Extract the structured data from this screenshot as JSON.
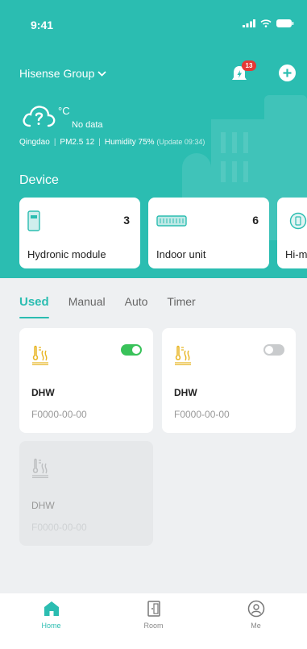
{
  "status_bar": {
    "time": "9:41"
  },
  "header": {
    "group_name": "Hisense Group",
    "notification_count": "13"
  },
  "weather": {
    "unit": "°C",
    "status": "No data",
    "city": "Qingdao",
    "pm25": "PM2.5 12",
    "humidity": "Humidity 75%",
    "updated": "(Update 09:34)"
  },
  "devices": {
    "title": "Device",
    "items": [
      {
        "name": "Hydronic module",
        "count": "3",
        "icon": "hydronic-module-icon"
      },
      {
        "name": "Indoor unit",
        "count": "6",
        "icon": "indoor-unit-icon"
      },
      {
        "name": "Hi-m",
        "count": "",
        "icon": "hi-m-icon"
      }
    ]
  },
  "scene_tabs": {
    "active": "Used",
    "items": [
      {
        "label": "Used"
      },
      {
        "label": "Manual"
      },
      {
        "label": "Auto"
      },
      {
        "label": "Timer"
      }
    ]
  },
  "scenes": [
    {
      "name": "DHW",
      "code": "F0000-00-00",
      "toggle": "on",
      "icon": "dhw-icon"
    },
    {
      "name": "DHW",
      "code": "F0000-00-00",
      "toggle": "off",
      "icon": "dhw-icon"
    },
    {
      "name": "DHW",
      "code": "F0000-00-00",
      "toggle": "none",
      "icon": "dhw-icon",
      "disabled": true
    }
  ],
  "bottom_nav": {
    "active": "Home",
    "items": [
      {
        "label": "Home",
        "icon": "home-icon"
      },
      {
        "label": "Room",
        "icon": "room-icon"
      },
      {
        "label": "Me",
        "icon": "me-icon"
      }
    ]
  },
  "colors": {
    "accent": "#2bbdb1",
    "toggle_on": "#39c25a",
    "badge": "#e53935",
    "icon_yellow": "#e8b626"
  }
}
